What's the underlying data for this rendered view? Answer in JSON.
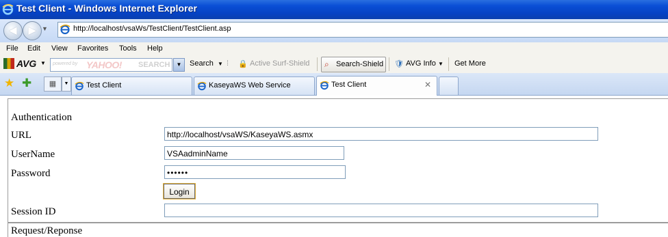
{
  "window": {
    "title": "Test Client - Windows Internet Explorer"
  },
  "address": {
    "url": "http://localhost/vsaWs/TestClient/TestClient.asp"
  },
  "menu": [
    "File",
    "Edit",
    "View",
    "Favorites",
    "Tools",
    "Help"
  ],
  "avg_toolbar": {
    "logo": "AVG",
    "search_powered": "powered by",
    "search_brand": "YAHOO!",
    "search_word": "SEARCH",
    "search_label": "Search",
    "active_surf_shield": "Active Surf-Shield",
    "search_shield": "Search-Shield",
    "avg_info": "AVG Info",
    "get_more": "Get More"
  },
  "tabs": [
    {
      "label": "Test Client"
    },
    {
      "label": "KaseyaWS Web Service"
    },
    {
      "label": "Test Client",
      "active": true
    }
  ],
  "form": {
    "section_title": "Authentication",
    "url_label": "URL",
    "url_value": "http://localhost/vsaWS/KaseyaWS.asmx",
    "username_label": "UserName",
    "username_value": "VSAadminName",
    "password_label": "Password",
    "password_value": "••••••",
    "login_button": "Login",
    "session_label": "Session ID",
    "session_value": "",
    "next_section": "Request/Reponse"
  },
  "colors": {
    "title_bar": "#0a4fd6",
    "focus_outline": "#e3b03b"
  }
}
